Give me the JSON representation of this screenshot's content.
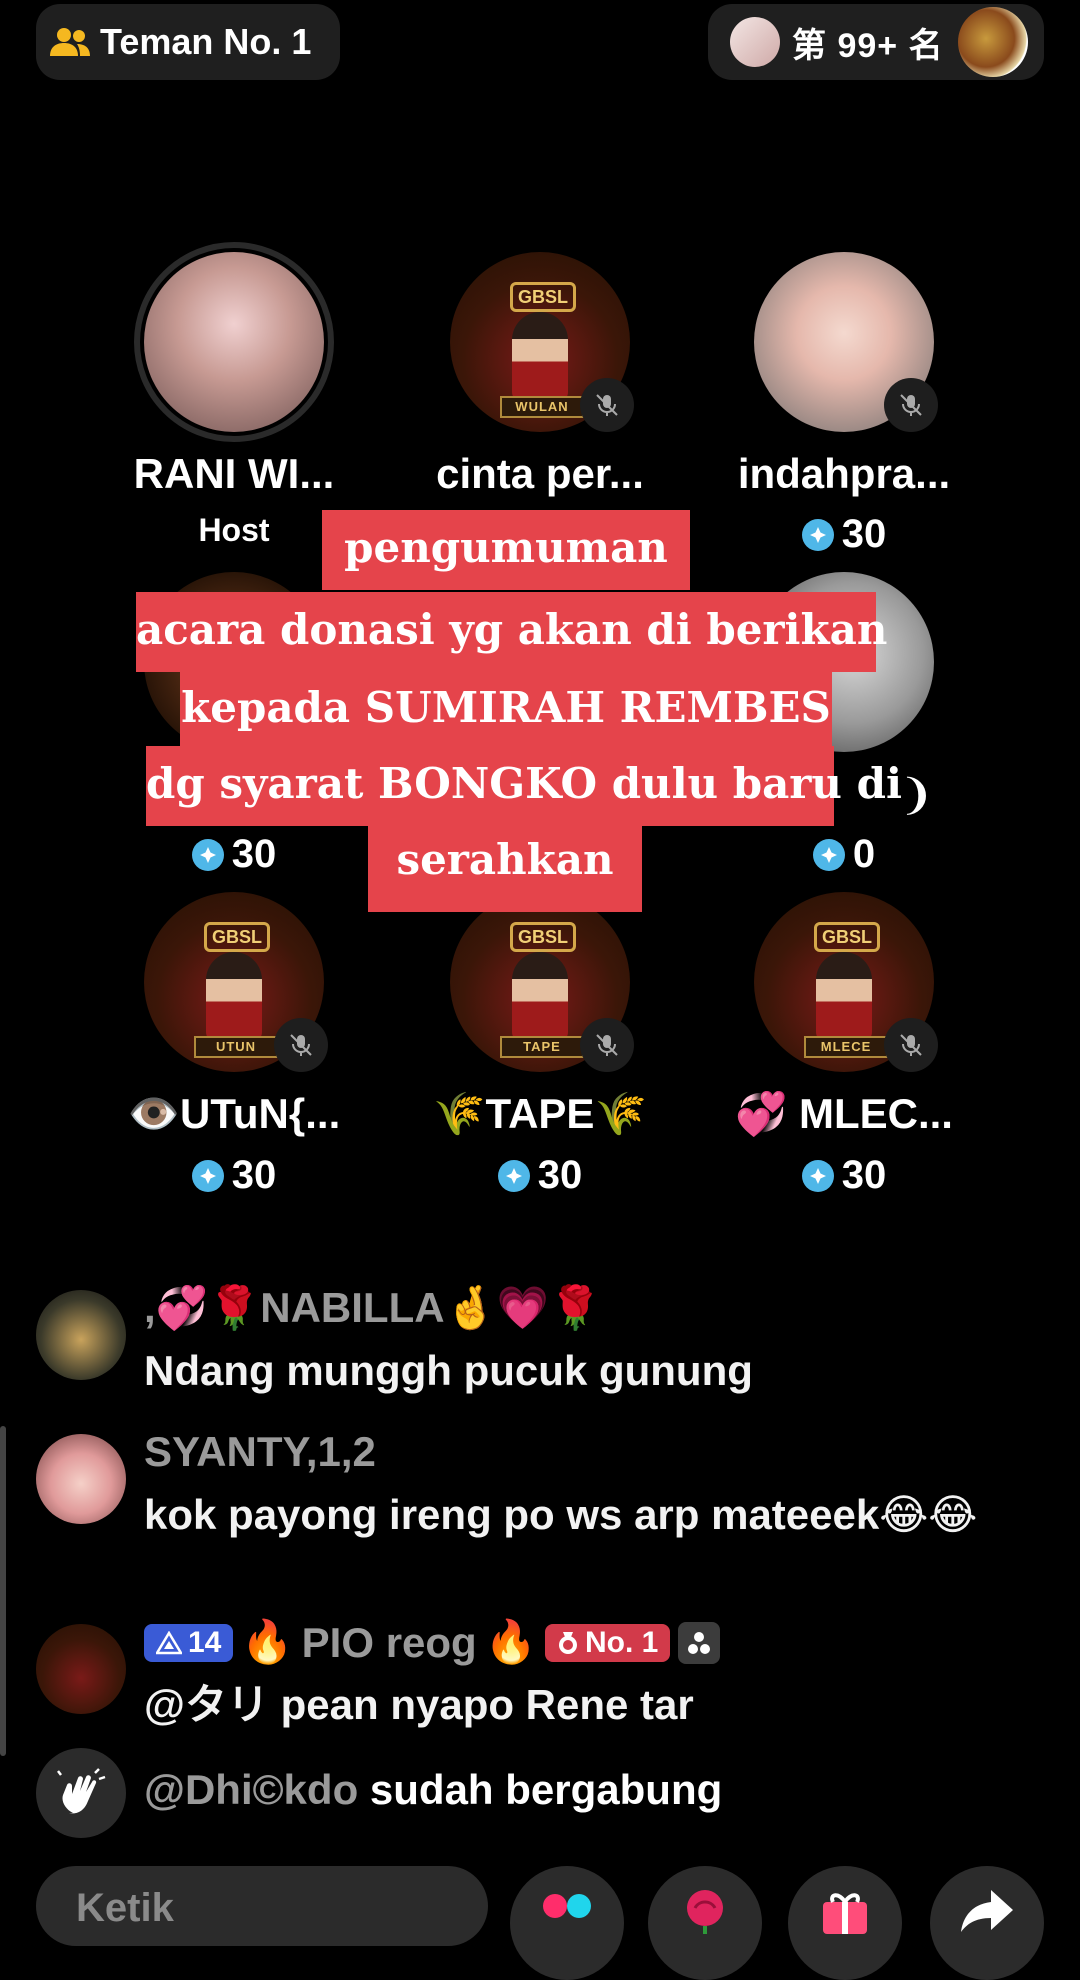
{
  "top_bar": {
    "team_label": "Teman No. 1",
    "rank_label": "第 99+ 名"
  },
  "seats": [
    {
      "name": "RANI WI...",
      "sub": "Host"
    },
    {
      "name": "cinta per...",
      "sub": "",
      "plate": "WULAN"
    },
    {
      "name": "indahpra...",
      "score": "30"
    },
    {
      "name": "",
      "score": "30"
    },
    {
      "name": "",
      "score": ""
    },
    {
      "name": "❩",
      "score": "0"
    },
    {
      "name": "👁️UTuN{...",
      "score": "30",
      "plate": "UTUN"
    },
    {
      "name": "🌾TAPE🌾",
      "score": "30",
      "plate": "TAPE"
    },
    {
      "name": "💞 MLEC...",
      "score": "30",
      "plate": "MLECE"
    }
  ],
  "gbsl_logo": "GBSL",
  "announcement": {
    "line1": "pengumuman",
    "line2": "acara donasi yg akan di berikan",
    "line3": "kepada SUMIRAH REMBES",
    "line4": "dg syarat BONGKO dulu baru di",
    "line5": "serahkan"
  },
  "comments": [
    {
      "user": ",💞🌹NABILLA🤞💗🌹",
      "message": "Ndang munggh pucuk gunung"
    },
    {
      "user": "SYANTY,1,2",
      "message": "kok payong ireng po ws arp mateeek😂😂"
    },
    {
      "user": "PIO reog",
      "level": "14",
      "rank_badge": "No. 1",
      "message": "@タリ pean nyapo Rene tar",
      "fire": "🔥"
    }
  ],
  "join": {
    "who": "@Dhi©kdo",
    "text": "sudah bergabung"
  },
  "input": {
    "placeholder": "Ketik"
  }
}
